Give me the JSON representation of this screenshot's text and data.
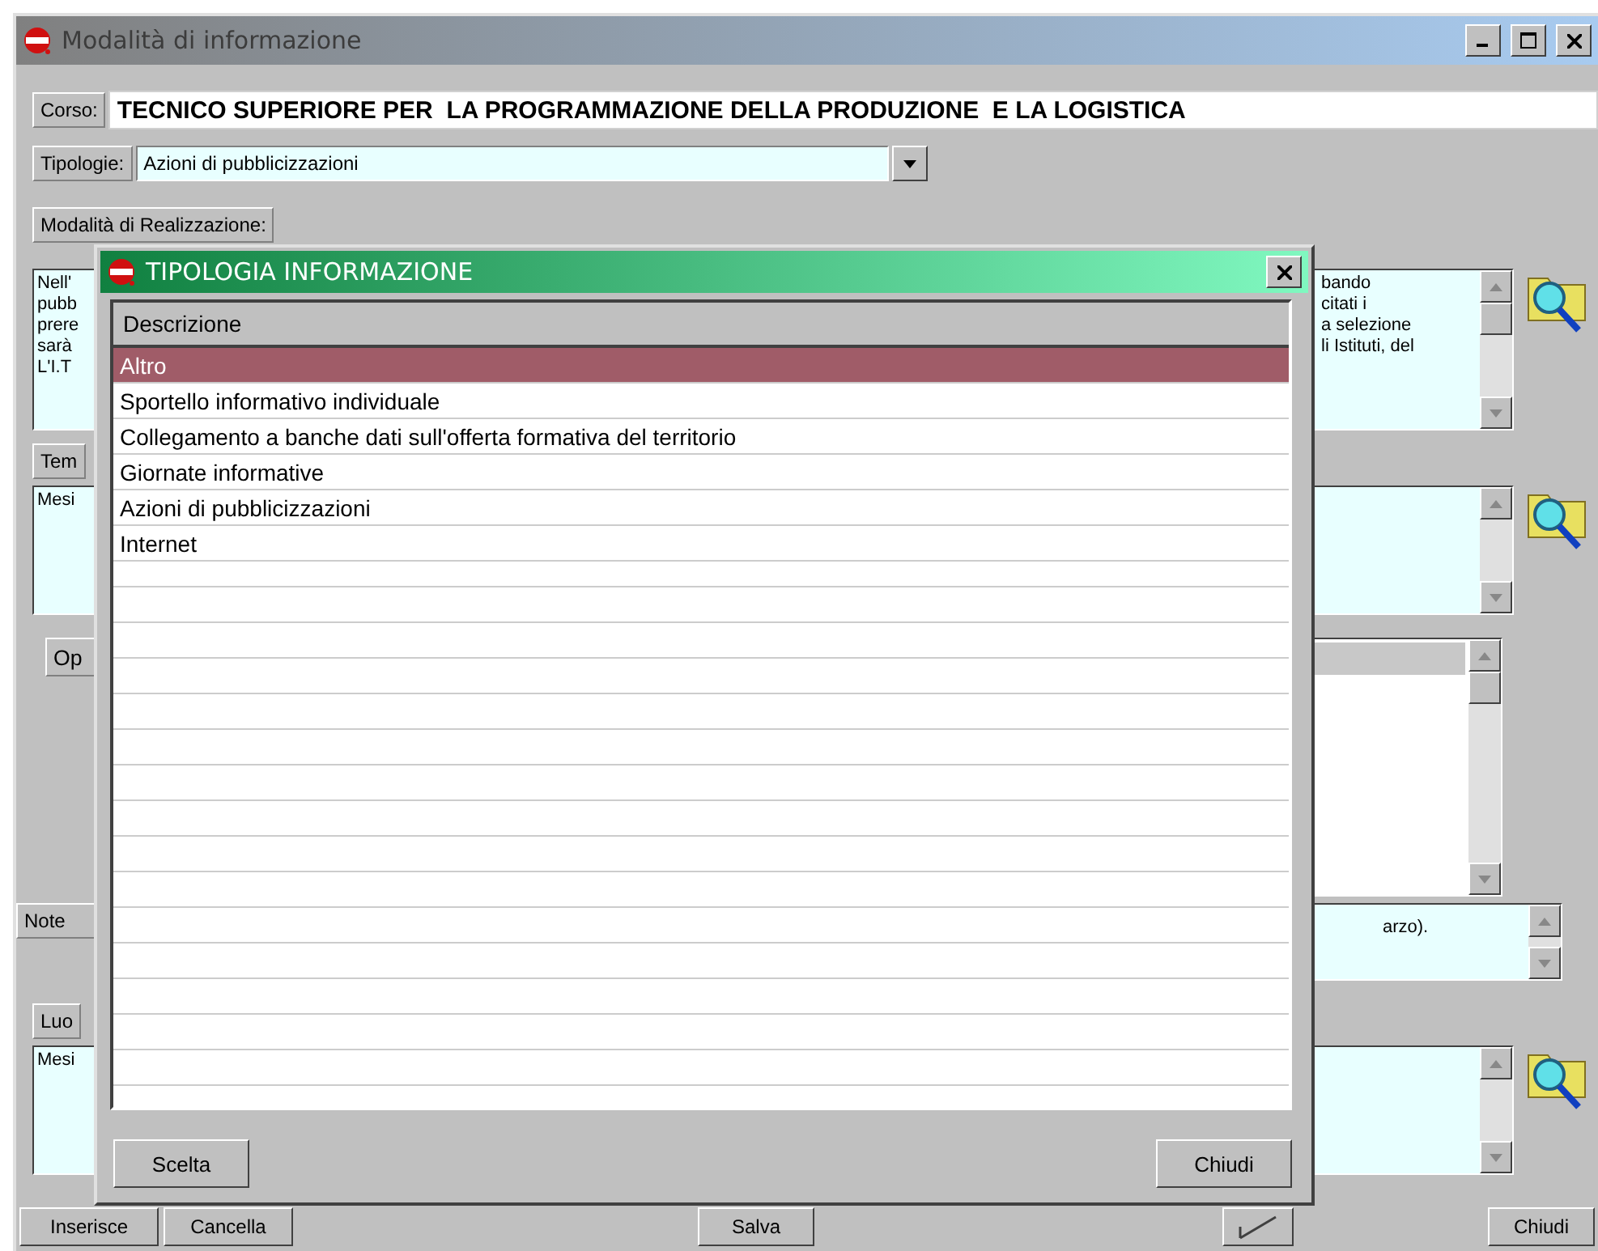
{
  "window": {
    "title": "Modalità di informazione"
  },
  "corso": {
    "label": "Corso:",
    "value": "TECNICO SUPERIORE PER  LA PROGRAMMAZIONE DELLA PRODUZIONE  E LA LOGISTICA"
  },
  "tipologie": {
    "label": "Tipologie:",
    "value": "Azioni di pubblicizzazioni"
  },
  "modalita": {
    "label": "Modalità di Realizzazione:",
    "left_lines": [
      "Nell'",
      "pubb",
      "prere",
      "sarà",
      "L'I.T"
    ],
    "right_lines": [
      "bando",
      "citati i",
      "a selezione",
      "li Istituti, del"
    ]
  },
  "tempi": {
    "label": "Tem",
    "text": "Mesi"
  },
  "operatori": {
    "label": "Op"
  },
  "note": {
    "label": "Note",
    "text": "arzo)."
  },
  "luogo": {
    "label": "Luo",
    "text": "Mesi"
  },
  "buttons": [
    {
      "kind": "text",
      "label": "Inserisce"
    },
    {
      "kind": "text",
      "label": "Cancella"
    },
    {
      "kind": "text",
      "label": "Salva"
    },
    {
      "kind": "icon"
    },
    {
      "kind": "text",
      "label": "Chiudi"
    }
  ],
  "dialog": {
    "title": "TIPOLOGIA INFORMAZIONE",
    "column": "Descrizione",
    "items": [
      {
        "label": "Altro",
        "selected": true
      },
      {
        "label": "Sportello informativo individuale",
        "selected": false
      },
      {
        "label": "Collegamento a banche dati sull'offerta formativa del territorio",
        "selected": false
      },
      {
        "label": "Giornate informative",
        "selected": false
      },
      {
        "label": "Azioni di pubblicizzazioni",
        "selected": false
      },
      {
        "label": "Internet",
        "selected": false
      }
    ],
    "buttons": [
      "Scelta",
      "Chiudi"
    ]
  }
}
